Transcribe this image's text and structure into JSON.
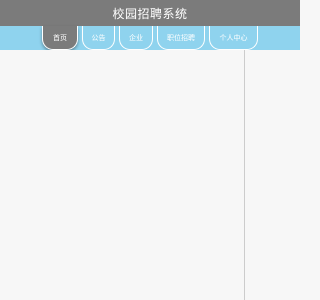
{
  "header": {
    "title": "校园招聘系统"
  },
  "nav": {
    "tabs": [
      {
        "label": "首页",
        "active": true
      },
      {
        "label": "公告",
        "active": false
      },
      {
        "label": "企业",
        "active": false
      },
      {
        "label": "职位招聘",
        "active": false
      },
      {
        "label": "个人中心",
        "active": false
      }
    ]
  },
  "colors": {
    "titlebar": "#7b7b7b",
    "navbar": "#8fd3ee",
    "active_tab": "#7b7b7b",
    "background": "#f7f7f7"
  }
}
